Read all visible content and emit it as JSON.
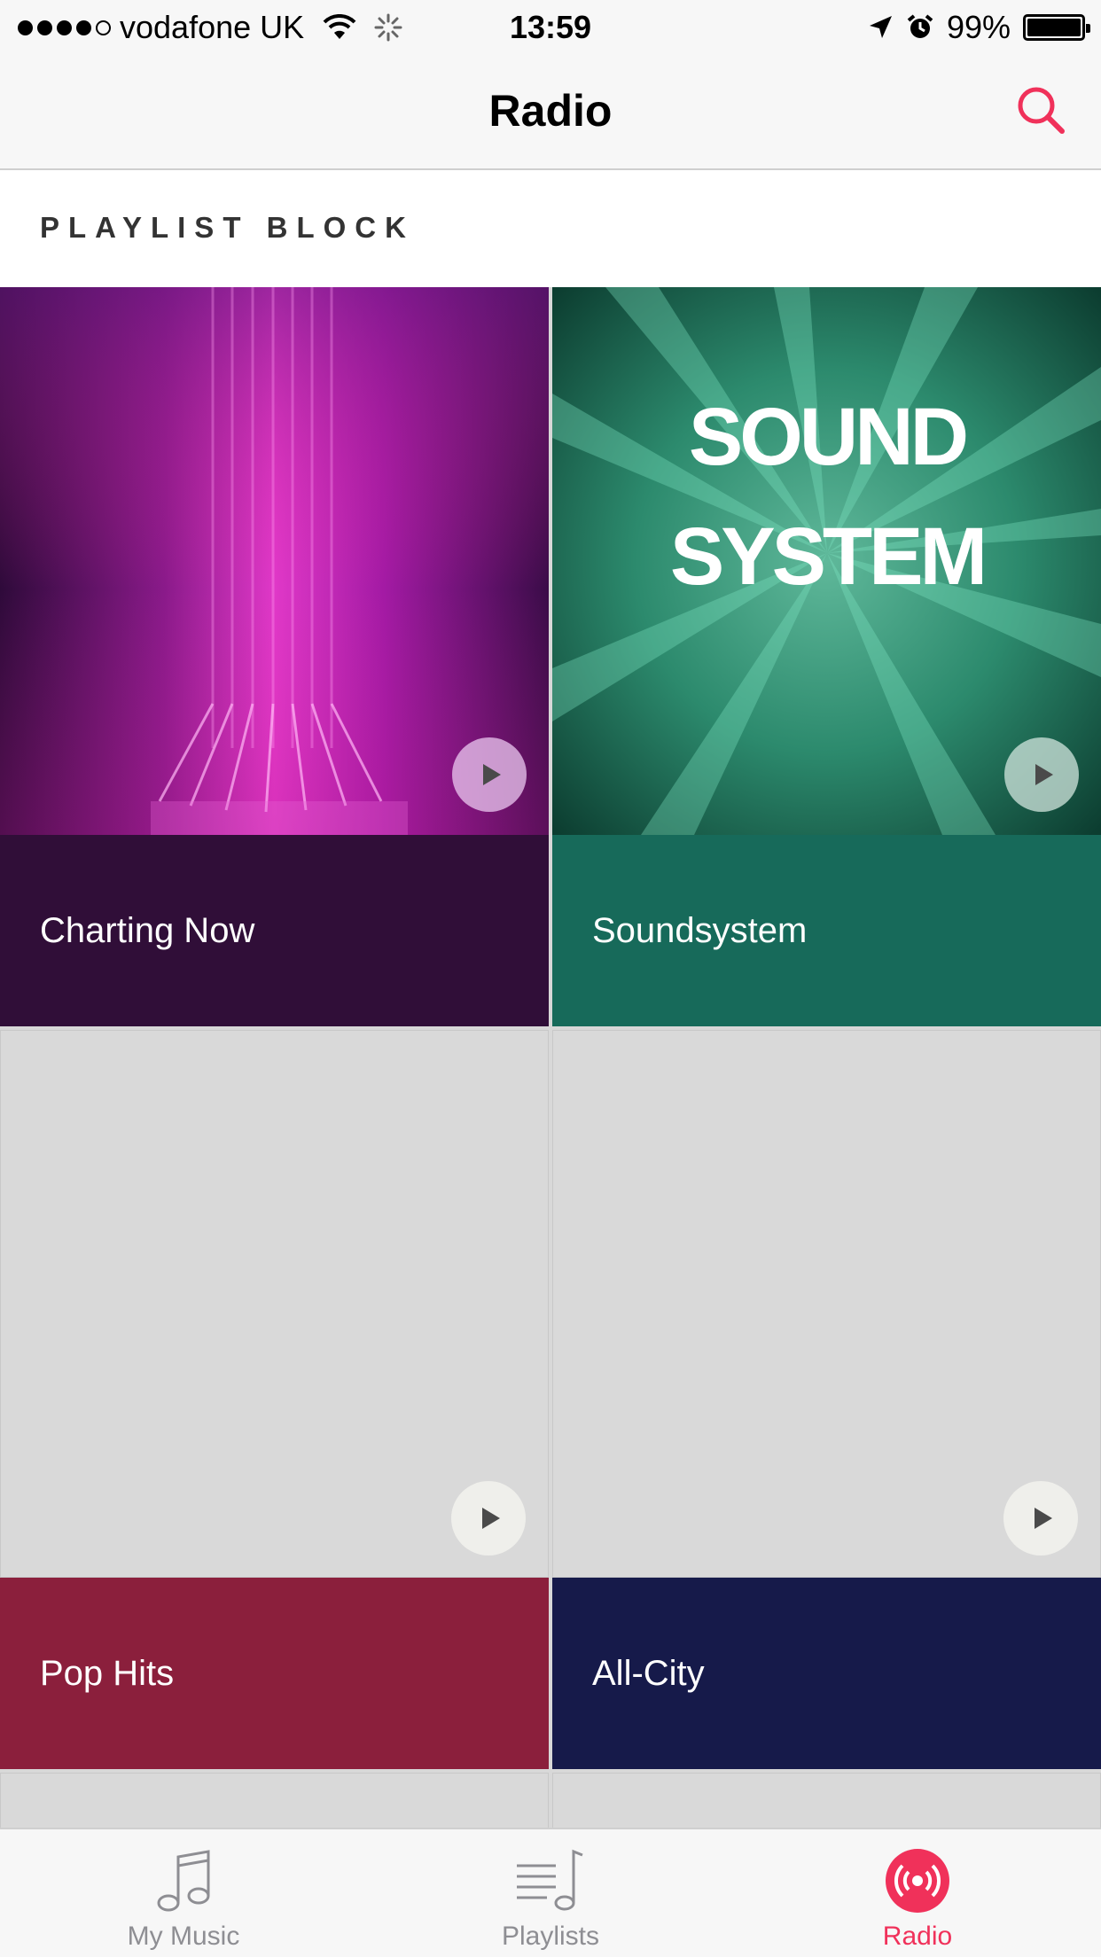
{
  "status_bar": {
    "carrier": "vodafone UK",
    "signal_bars": 4,
    "signal_total": 5,
    "time": "13:59",
    "battery_percent": "99%"
  },
  "nav": {
    "title": "Radio"
  },
  "section": {
    "title": "PLAYLIST BLOCK"
  },
  "stations": [
    {
      "name": "Charting Now",
      "label_color": "#300e38",
      "art": "magenta-light-beams"
    },
    {
      "name": "Soundsystem",
      "label_color": "#176a5a",
      "art": "green-burst",
      "art_text": [
        "SOUND",
        "SYSTEM"
      ]
    },
    {
      "name": "Pop Hits",
      "label_color": "#8b1f3c",
      "art": "placeholder"
    },
    {
      "name": "All-City",
      "label_color": "#161a4a",
      "art": "placeholder"
    }
  ],
  "tab_bar": {
    "tabs": [
      {
        "label": "My Music",
        "icon": "music-note-icon",
        "active": false
      },
      {
        "label": "Playlists",
        "icon": "playlist-icon",
        "active": false
      },
      {
        "label": "Radio",
        "icon": "radio-broadcast-icon",
        "active": true
      }
    ]
  },
  "colors": {
    "accent": "#f0315a",
    "bar_background": "#f7f7f7",
    "placeholder": "#d9d9d9"
  }
}
